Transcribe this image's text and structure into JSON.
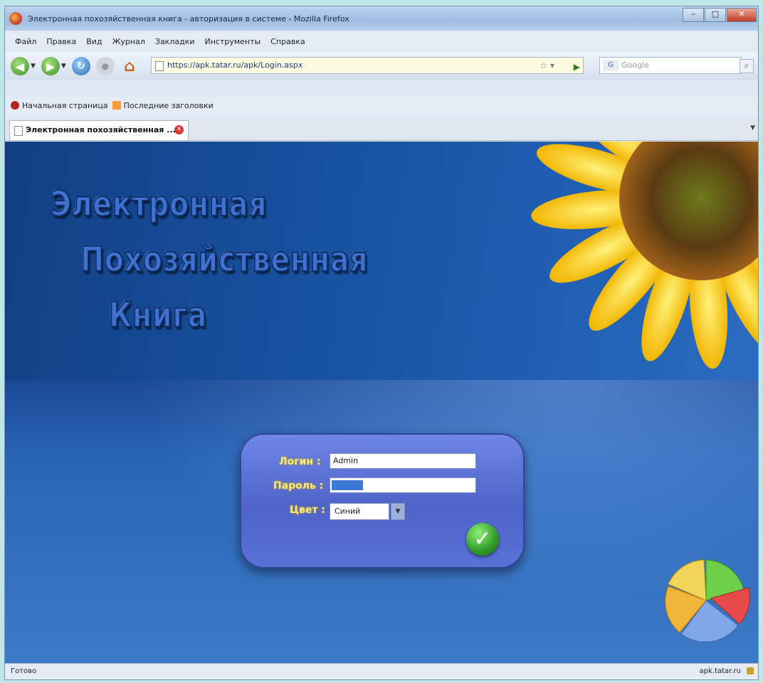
{
  "window": {
    "title": "Электронная похозяйственная книга - авторизация в системе - Mozilla Firefox",
    "controls": [
      "–",
      "□",
      "✕"
    ]
  },
  "menu": [
    "Файл",
    "Правка",
    "Вид",
    "Журнал",
    "Закладки",
    "Инструменты",
    "Справка"
  ],
  "nav": {
    "url": "https://apk.tatar.ru/apk/Login.aspx",
    "search_placeholder": "Google",
    "search_engine": "G"
  },
  "bookmarks": [
    "Начальная страница",
    "Последние заголовки"
  ],
  "tab": {
    "label": "Электронная похозяйственная ..."
  },
  "page": {
    "heading_line1": "Электронная",
    "heading_line2": "Похозяйственная",
    "heading_line3": "Книга",
    "login_label": "Логин :",
    "login_value": "Admin",
    "password_label": "Пароль :",
    "color_label": "Цвет :",
    "color_value": "Синий"
  },
  "status": {
    "left": "Готово",
    "right": "apk.tatar.ru"
  },
  "colors": {
    "page_bg": "#1e56a6",
    "label_color": "#f7e97a",
    "panel": "#5a72d8"
  }
}
